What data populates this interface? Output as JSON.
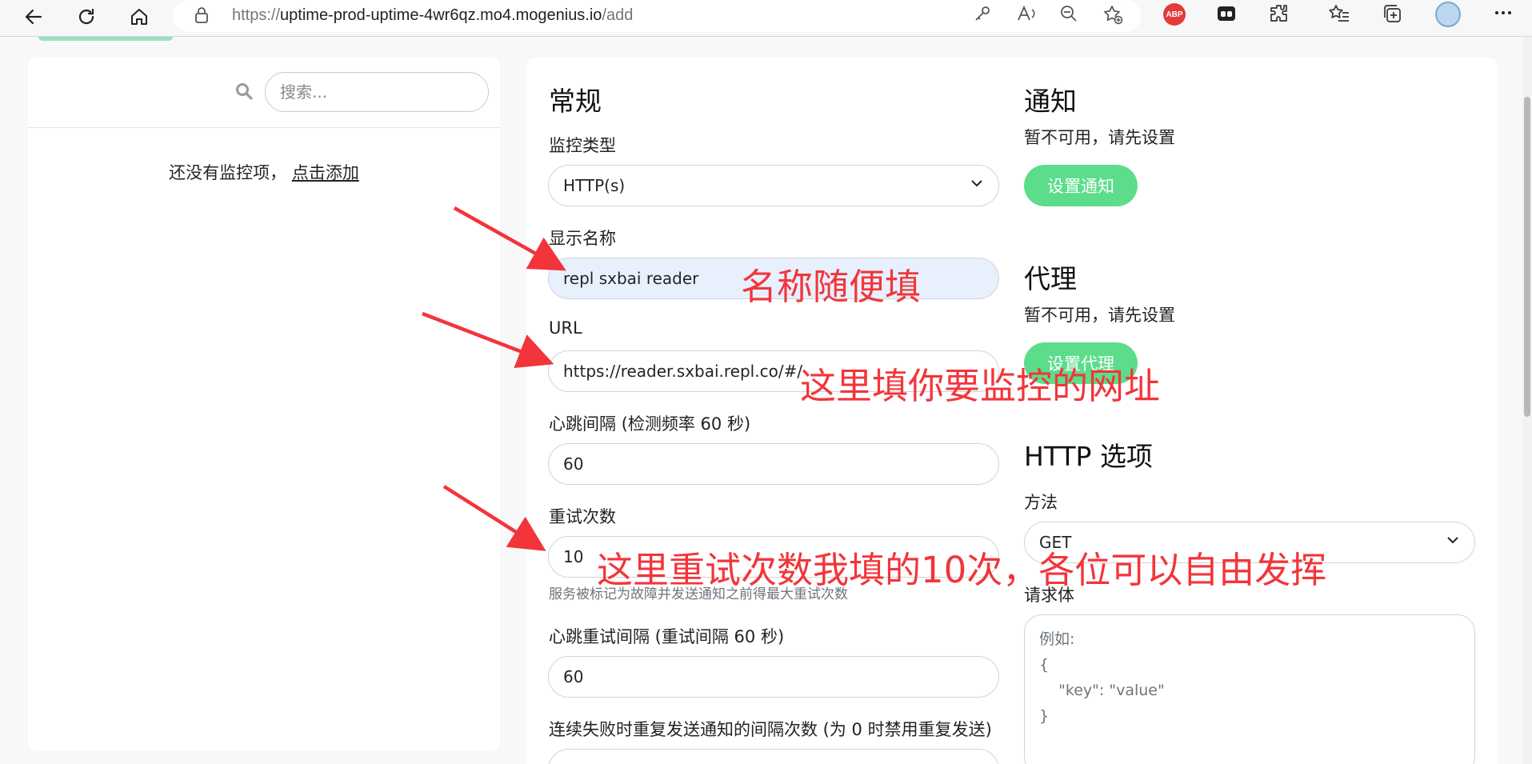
{
  "browser": {
    "url_proto": "https://",
    "url_host": "uptime-prod-uptime-4wr6qz.mo4.mogenius.io",
    "url_path": "/add",
    "abp_label": "ABP",
    "icons": [
      "back-icon",
      "refresh-icon",
      "home-icon",
      "lock-icon",
      "key-icon",
      "read-aloud-icon",
      "zoom-out-icon",
      "add-favorite-icon",
      "adblock-icon",
      "tab-ext-icon",
      "extensions-icon",
      "favorites-icon",
      "collections-icon",
      "profile-avatar",
      "more-icon"
    ]
  },
  "sidebar": {
    "search_placeholder": "搜索...",
    "empty_text": "还没有监控项，",
    "empty_link": "点击添加"
  },
  "general": {
    "heading": "常规",
    "monitor_type_label": "监控类型",
    "monitor_type_value": "HTTP(s)",
    "display_name_label": "显示名称",
    "display_name_value": "repl sxbai reader",
    "url_label": "URL",
    "url_value": "https://reader.sxbai.repl.co/#/",
    "interval_label": "心跳间隔 (检测频率 60 秒)",
    "interval_value": "60",
    "retries_label": "重试次数",
    "retries_value": "10",
    "retries_help": "服务被标记为故障并发送通知之前得最大重试次数",
    "retry_interval_label": "心跳重试间隔 (重试间隔 60 秒)",
    "retry_interval_value": "60",
    "resend_label": "连续失败时重复发送通知的间隔次数 (为 0 时禁用重复发送)"
  },
  "notifications": {
    "heading": "通知",
    "unavailable": "暂不可用，请先设置",
    "setup_button": "设置通知"
  },
  "proxy": {
    "heading": "代理",
    "unavailable": "暂不可用，请先设置",
    "setup_button": "设置代理"
  },
  "http_options": {
    "heading": "HTTP 选项",
    "method_label": "方法",
    "method_value": "GET",
    "body_label": "请求体",
    "body_placeholder": "例如:\n{\n    \"key\": \"value\"\n}"
  },
  "annotations": {
    "name": "名称随便填",
    "url": "这里填你要监控的网址",
    "retries": "这里重试次数我填的10次，各位可以自由发挥"
  },
  "colors": {
    "accent_green": "#5cdd8b",
    "annotation_red": "#f2353a",
    "autofill_blue": "#e8f0fe"
  }
}
